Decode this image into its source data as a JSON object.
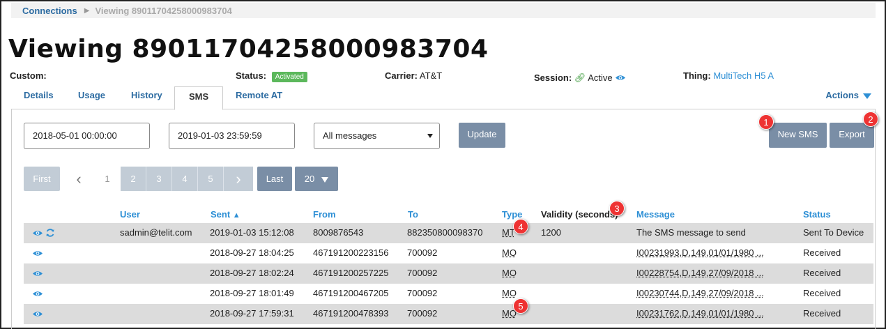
{
  "breadcrumb": {
    "root": "Connections",
    "current": "Viewing 89011704258000983704"
  },
  "page_title": "Viewing 89011704258000983704",
  "meta": {
    "custom_label": "Custom:",
    "status_label": "Status:",
    "status_value": "Activated",
    "carrier_label": "Carrier:",
    "carrier_value": "AT&T",
    "session_label": "Session:",
    "session_value": "Active",
    "thing_label": "Thing:",
    "thing_value": "MultiTech H5 A"
  },
  "tabs": [
    {
      "label": "Details"
    },
    {
      "label": "Usage"
    },
    {
      "label": "History"
    },
    {
      "label": "SMS"
    },
    {
      "label": "Remote AT"
    }
  ],
  "actions_label": "Actions",
  "filters": {
    "start_date": "2018-05-01 00:00:00",
    "end_date": "2019-01-03 23:59:59",
    "message_filter": "All messages",
    "update_label": "Update"
  },
  "buttons": {
    "new_sms": "New SMS",
    "export": "Export"
  },
  "pagination": {
    "first": "First",
    "prev": "‹",
    "pages": [
      "1",
      "2",
      "3",
      "4",
      "5"
    ],
    "next": "›",
    "last": "Last",
    "page_size": "20"
  },
  "table": {
    "headers": {
      "user": "User",
      "sent": "Sent",
      "from": "From",
      "to": "To",
      "type": "Type",
      "validity": "Validity (seconds)",
      "message": "Message",
      "status": "Status"
    },
    "sort_indicator": "🡅",
    "rows": [
      {
        "user": "sadmin@telit.com",
        "sent": "2019-01-03 15:12:08",
        "from": "8009876543",
        "to": "882350800098370",
        "type": "MT",
        "validity": "1200",
        "message": "The SMS message to send",
        "status": "Sent To Device"
      },
      {
        "user": "",
        "sent": "2018-09-27 18:04:25",
        "from": "467191200223156",
        "to": "700092",
        "type": "MO",
        "validity": "",
        "message": "I00231993,D,149,01/01/1980 ...",
        "status": "Received"
      },
      {
        "user": "",
        "sent": "2018-09-27 18:02:24",
        "from": "467191200257225",
        "to": "700092",
        "type": "MO",
        "validity": "",
        "message": "I00228754,D,149,27/09/2018 ...",
        "status": "Received"
      },
      {
        "user": "",
        "sent": "2018-09-27 18:01:49",
        "from": "467191200467205",
        "to": "700092",
        "type": "MO",
        "validity": "",
        "message": "I00230744,D,149,27/09/2018 ...",
        "status": "Received"
      },
      {
        "user": "",
        "sent": "2018-09-27 17:59:31",
        "from": "467191200478393",
        "to": "700092",
        "type": "MO",
        "validity": "",
        "message": "I00231762,D,149,01/01/1980 ...",
        "status": "Received"
      }
    ]
  },
  "markers": [
    "1",
    "2",
    "3",
    "4",
    "5"
  ],
  "colors": {
    "link": "#2d6ca2",
    "accent": "#2d8fd5",
    "button": "#7a8ea6",
    "badge": "#5cb85c",
    "marker": "#ee3333"
  }
}
